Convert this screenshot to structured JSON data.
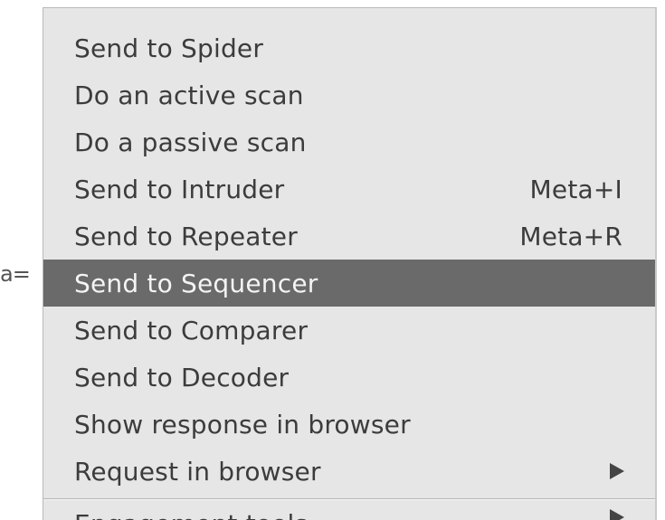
{
  "background_fragment": "a=",
  "menu": {
    "items": [
      {
        "label": "Send to Spider",
        "shortcut": ""
      },
      {
        "label": "Do an active scan",
        "shortcut": ""
      },
      {
        "label": "Do a passive scan",
        "shortcut": ""
      },
      {
        "label": "Send to Intruder",
        "shortcut": "Meta+I"
      },
      {
        "label": "Send to Repeater",
        "shortcut": "Meta+R"
      },
      {
        "label": "Send to Sequencer",
        "shortcut": ""
      },
      {
        "label": "Send to Comparer",
        "shortcut": ""
      },
      {
        "label": "Send to Decoder",
        "shortcut": ""
      },
      {
        "label": "Show response in browser",
        "shortcut": ""
      },
      {
        "label": "Request in browser",
        "shortcut": "",
        "submenu_icon": "triangle-right-icon"
      }
    ],
    "selected_index": 5,
    "cut_item": {
      "label": "Engagement tools",
      "submenu_icon": "triangle-right-icon"
    }
  },
  "colors": {
    "menu_background": "#e6e6e6",
    "selected_background": "#6a6a6a",
    "selected_text": "#f4f4f4",
    "text": "#3c3c3c"
  }
}
